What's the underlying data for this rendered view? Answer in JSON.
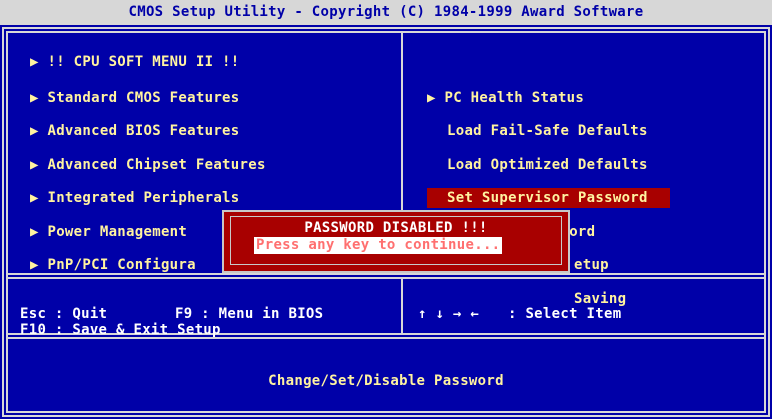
{
  "title": "CMOS Setup Utility - Copyright (C) 1984-1999 Award Software",
  "left_menu": [
    {
      "arrow": "▶",
      "label": "!! CPU SOFT MENU II !!"
    },
    {
      "arrow": "▶",
      "label": "Standard CMOS Features"
    },
    {
      "arrow": "▶",
      "label": "Advanced BIOS Features"
    },
    {
      "arrow": "▶",
      "label": "Advanced Chipset Features"
    },
    {
      "arrow": "▶",
      "label": "Integrated Peripherals"
    },
    {
      "arrow": "▶",
      "label": "Power Management"
    },
    {
      "arrow": "▶",
      "label": "PnP/PCI Configura"
    }
  ],
  "right_menu": [
    {
      "arrow": "▶",
      "label": "PC Health Status"
    },
    {
      "arrow": "",
      "label": "Load Fail-Safe Defaults"
    },
    {
      "arrow": "",
      "label": "Load Optimized Defaults"
    },
    {
      "arrow": "",
      "label": "Set Supervisor Password",
      "selected": true
    },
    {
      "arrow": "",
      "label": "Set User Password"
    },
    {
      "arrow": "",
      "label": "etup"
    },
    {
      "arrow": "",
      "label": "Saving"
    }
  ],
  "popup": {
    "title": "PASSWORD DISABLED !!!",
    "message": "Press any key to continue..."
  },
  "help": {
    "esc": "Esc : Quit",
    "f9": "F9 : Menu in BIOS",
    "arrows": "↑ ↓ → ←",
    "select": ": Select Item",
    "f10": "F10 : Save & Exit Setup"
  },
  "description": "Change/Set/Disable Password",
  "colors": {
    "background": "#0000a8",
    "text": "#fff3a0",
    "highlight": "#a80000",
    "border": "#d7d7d7"
  }
}
